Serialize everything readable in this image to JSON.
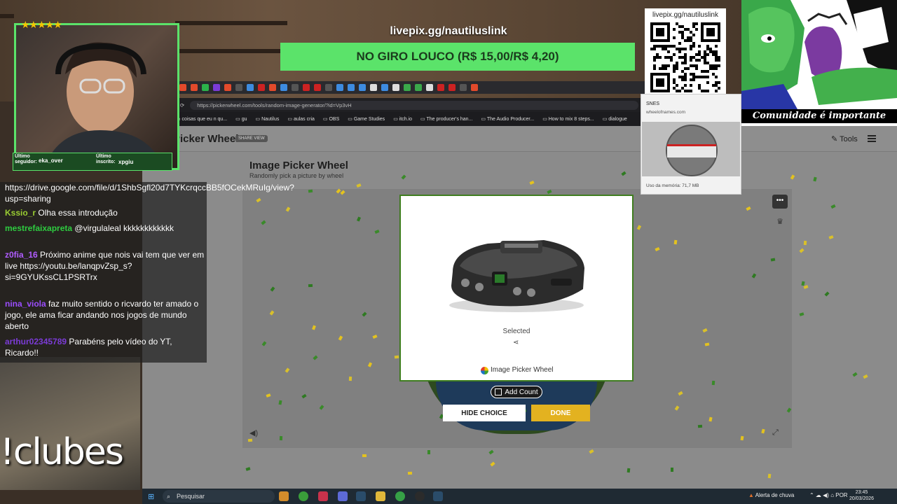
{
  "stream": {
    "pix_url": "livepix.gg/nautiluslink",
    "giro_banner": "NO GIRO LOUCO (R$ 15,00/R$ 4,20)",
    "qr_label": "livepix.gg/nautiluslink",
    "comic_caption": "Comunidade é importante",
    "clubes_command": "!clubes",
    "star_rating": "★★★★★",
    "last_follower_label": "Último seguidor:",
    "last_follower": "eka_over",
    "last_sub_label": "Último inscrito:",
    "last_sub": "xpgiu",
    "chat": [
      {
        "name": "",
        "text": "https://drive.google.com/file/d/1ShbSgfl20d7TYKcrqccBB5fOCekMRuIg/view?usp=sharing",
        "color": "#ffffff"
      },
      {
        "name": "Kssio_r",
        "text": "Olha essa introdução",
        "color": "#9acd32"
      },
      {
        "name": "mestrefaixapreta",
        "text": "@virgulaleal kkkkkkkkkkkk",
        "color": "#2ecc40"
      },
      {
        "name": "z0fia_16",
        "text": "Próximo anime que nois vai tem que ver em live https://youtu.be/lanqpvZsp_s?si=9GYUKssCL1PSRTrx",
        "color": "#b05cff"
      },
      {
        "name": "nina_viola",
        "text": "faz muito sentido o ricvardo ter amado o jogo, ele ama ficar andando nos jogos de mundo aberto",
        "color": "#9b4dff"
      },
      {
        "name": "arthur02345789",
        "text": "Parabéns pelo vídeo do YT, Ricardo!!",
        "color": "#7b3bd6"
      }
    ]
  },
  "browser": {
    "url": "https://pickerwheel.com/tools/random-image-generator/?id=Vp3vH",
    "bookmarks": [
      "coisas que eu n qu...",
      "gu",
      "Nautilus",
      "aulas cria",
      "OBS",
      "Game Studies",
      "itch.io",
      "The producer's han...",
      "The Audio Producer...",
      "How to mix 8 steps...",
      "dialogue"
    ]
  },
  "memory_popup": {
    "title": "SNES",
    "site": "wheelofnames.com",
    "usage": "Uso da memória: 71,7 MB"
  },
  "site": {
    "logo": "Picker Wheel",
    "share_badge": "SHARE VIEW",
    "tools_label": "Tools",
    "tool_title": "Image Picker Wheel",
    "tool_subtitle": "Randomly pick a picture by wheel"
  },
  "result_modal": {
    "selected_label": "Selected",
    "brand_label": "Image Picker Wheel",
    "add_count_label": "Add Count",
    "hide_choice_label": "HIDE CHOICE",
    "done_label": "DONE"
  },
  "taskbar": {
    "search_placeholder": "Pesquisar",
    "weather": "Alerta de chuva",
    "language": "POR",
    "time": "23:45",
    "date": "20/03/2026"
  },
  "colors": {
    "accent_green": "#5be36a",
    "done_yellow": "#e3b220",
    "modal_border": "#3f7d1f"
  }
}
